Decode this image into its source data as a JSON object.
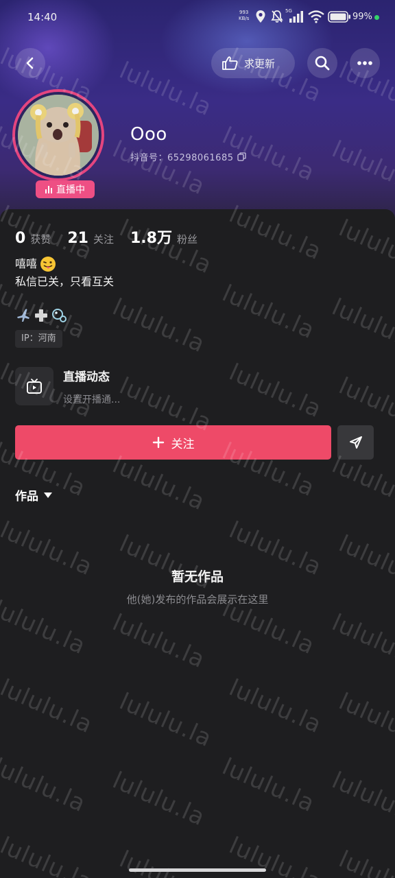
{
  "status_bar": {
    "time": "14:40",
    "speed_value": "993",
    "speed_unit": "KB/s",
    "network_label": "5G",
    "battery": "99%"
  },
  "header": {
    "update_label": "求更新"
  },
  "profile": {
    "nickname": "Ooo",
    "douyin_id": "抖音号：65298061685",
    "live_badge": "直播中"
  },
  "stats": [
    {
      "value": "0",
      "label": "获赞"
    },
    {
      "value": "21",
      "label": "关注"
    },
    {
      "value": "1.8万",
      "label": "粉丝"
    }
  ],
  "bio": {
    "line1": "嘻嘻",
    "line2": "私信已关，只看互关"
  },
  "ip": "IP：河南",
  "live_section": {
    "title": "直播动态",
    "subtitle": "设置开播通..."
  },
  "actions": {
    "follow_label": "关注"
  },
  "works": {
    "tab_label": "作品",
    "empty_title": "暂无作品",
    "empty_subtitle": "他(她)发布的作品会展示在这里"
  },
  "watermark_text": "lululu.la",
  "colors": {
    "accent_pink": "#ee4a68",
    "live_pink": "#ee4f84",
    "card_bg": "#1e1e20"
  }
}
